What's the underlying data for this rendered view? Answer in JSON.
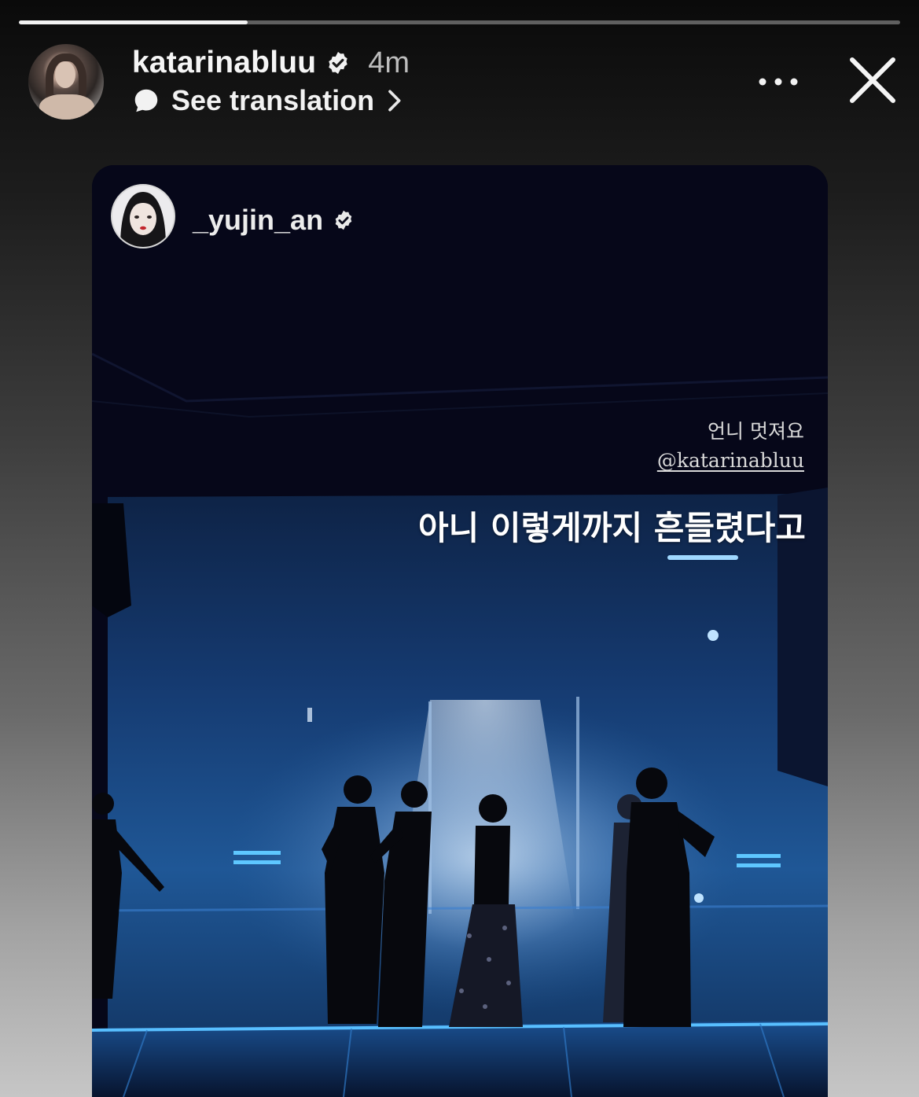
{
  "story": {
    "progress": 0.26
  },
  "header": {
    "username": "katarinabluu",
    "time_ago": "4m",
    "translate_label": "See translation"
  },
  "icons": {
    "verified": "verified-badge-icon",
    "speech": "speech-bubble-icon",
    "chevron": "chevron-right-icon",
    "more": "more-dots-icon",
    "close": "close-icon"
  },
  "shared_post": {
    "username": "_yujin_an",
    "caption_line1": "언니 멋져요",
    "caption_mention": "@katarinabluu",
    "overlay_text": "아니 이렇게까지 흔들렸다고"
  },
  "colors": {
    "stage_blue": "#2a6fb8",
    "stage_dark": "#060719"
  }
}
